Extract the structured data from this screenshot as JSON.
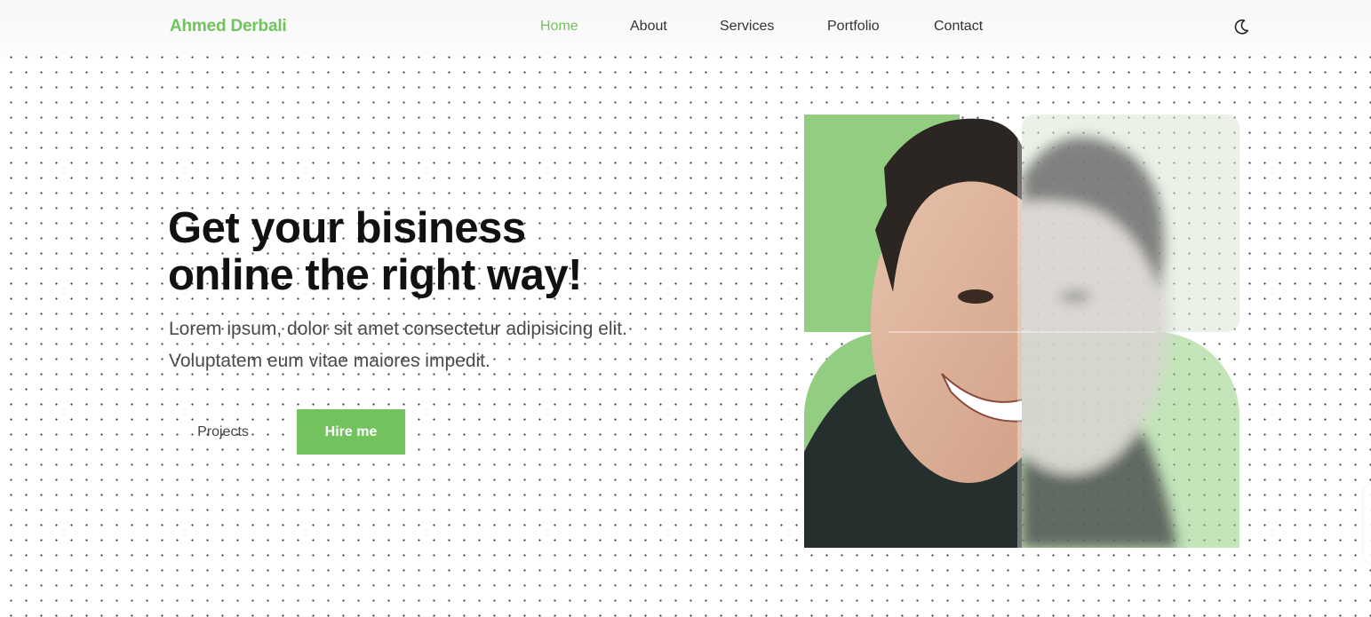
{
  "colors": {
    "accent": "#72c35d",
    "accent_light": "#93cd82",
    "text_dark": "#111111",
    "nav_text": "#333333"
  },
  "navbar": {
    "logo": "Ahmed Derbali",
    "links": [
      "Home",
      "About",
      "Services",
      "Portfolio",
      "Contact"
    ],
    "active_link": "Home",
    "theme_icon": "moon-icon"
  },
  "hero": {
    "headline": [
      "Get your bisiness",
      "online the right way!"
    ],
    "description": [
      "Lorem ipsum, dolor sit amet consectetur adipisicing elit.",
      "Voluptatem eum vitae maiores impedit."
    ],
    "buttons": {
      "projects": "Projects",
      "hire": "Hire me"
    },
    "image_icon": "profile-portrait-image"
  }
}
